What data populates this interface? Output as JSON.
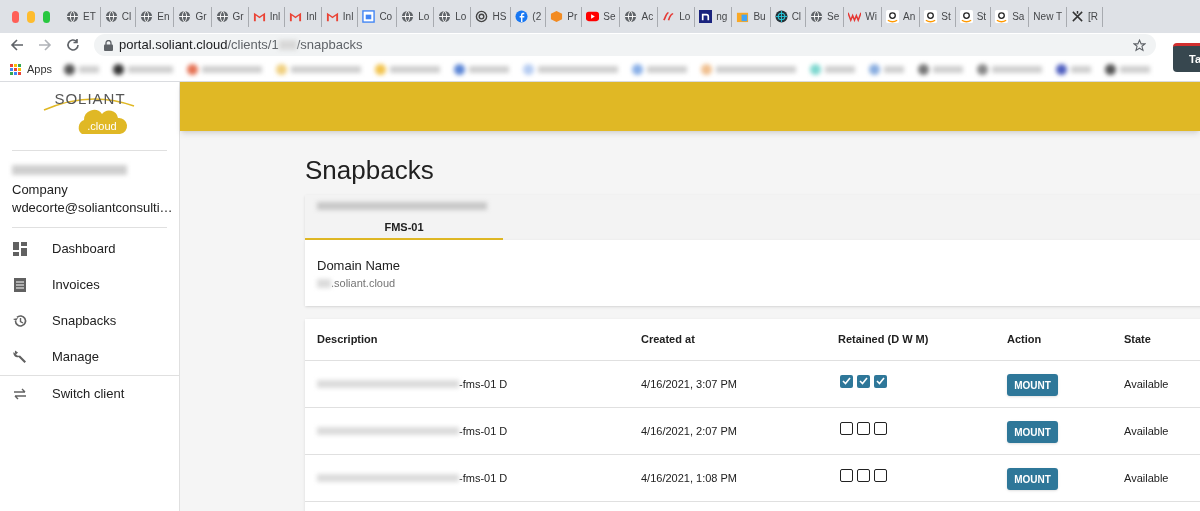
{
  "browser": {
    "tabs": [
      {
        "kind": "globe",
        "title": "ET"
      },
      {
        "kind": "globe",
        "title": "Cl"
      },
      {
        "kind": "globe",
        "title": "En"
      },
      {
        "kind": "globe",
        "title": "Gr"
      },
      {
        "kind": "globe",
        "title": "Gr"
      },
      {
        "kind": "mail",
        "title": "Inl"
      },
      {
        "kind": "mail",
        "title": "Inl"
      },
      {
        "kind": "mail",
        "title": "Inl"
      },
      {
        "kind": "calendar",
        "title": "Co"
      },
      {
        "kind": "globe",
        "title": "Lo"
      },
      {
        "kind": "globe",
        "title": "Lo"
      },
      {
        "kind": "spiral",
        "title": "HS"
      },
      {
        "kind": "facebook",
        "title": "(2"
      },
      {
        "kind": "cube",
        "title": "Pr"
      },
      {
        "kind": "play",
        "title": "Se"
      },
      {
        "kind": "globe",
        "title": "Ac"
      },
      {
        "kind": "script",
        "title": "Lo"
      },
      {
        "kind": "letter",
        "title": "ng"
      },
      {
        "kind": "box",
        "title": "Bu"
      },
      {
        "kind": "target",
        "title": "Cl"
      },
      {
        "kind": "globe",
        "title": "Se"
      },
      {
        "kind": "w",
        "title": "Wi"
      },
      {
        "kind": "amazon",
        "title": "An"
      },
      {
        "kind": "amazon",
        "title": "St"
      },
      {
        "kind": "amazon",
        "title": "St"
      },
      {
        "kind": "amazon",
        "title": "Sa"
      },
      {
        "kind": "plain",
        "title": "New T"
      },
      {
        "kind": "tool",
        "title": "[R"
      }
    ],
    "url_host": "portal.soliant.cloud",
    "url_path_start": "/clients/1",
    "url_path_end": "/snapbacks",
    "bookmarks": [
      {
        "label": "Apps"
      }
    ],
    "corner_popup": "Ta"
  },
  "sidebar": {
    "logo_word": "SOLIANT",
    "logo_sub": ".cloud",
    "company": "Company",
    "email": "wdecorte@soliantconsulti…",
    "items": [
      {
        "kind": "dashboard",
        "label": "Dashboard",
        "selected": false
      },
      {
        "kind": "invoice",
        "label": "Invoices",
        "selected": false
      },
      {
        "kind": "history",
        "label": "Snapbacks",
        "selected": false
      },
      {
        "kind": "wrench",
        "label": "Manage",
        "selected": false
      },
      {
        "kind": "swap",
        "label": "Switch client",
        "selected": false
      }
    ]
  },
  "page": {
    "title": "Snapbacks",
    "tabs": [
      {
        "label": "FMS-01",
        "selected": true
      }
    ],
    "domain_label": "Domain Name",
    "domain_value": ".soliant.cloud",
    "table": {
      "columns": [
        "Description",
        "Created at",
        "Retained (D W M)",
        "Action",
        "State"
      ],
      "rows": [
        {
          "description": "-fms-01 D",
          "created": "4/16/2021, 3:07 PM",
          "retained": [
            true,
            true,
            true
          ],
          "action": "MOUNT",
          "state": "Available"
        },
        {
          "description": "-fms-01 D",
          "created": "4/16/2021, 2:07 PM",
          "retained": [
            false,
            false,
            false
          ],
          "action": "MOUNT",
          "state": "Available"
        },
        {
          "description": "-fms-01 D",
          "created": "4/16/2021, 1:08 PM",
          "retained": [
            false,
            false,
            false
          ],
          "action": "MOUNT",
          "state": "Available"
        }
      ]
    }
  }
}
